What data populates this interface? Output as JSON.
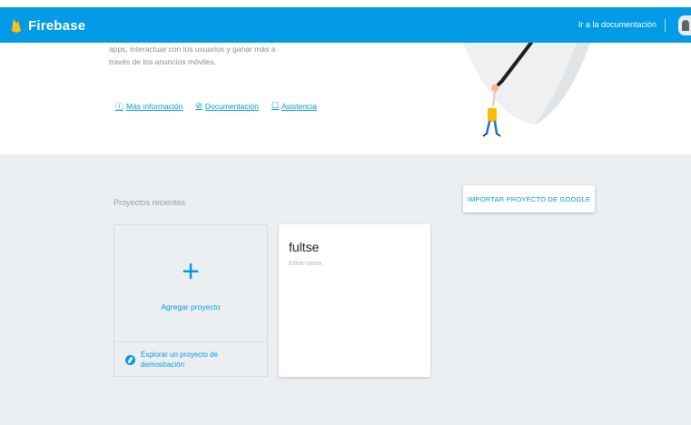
{
  "topbar": {
    "brand": "Firebase",
    "docs_link": "Ir a la documentación"
  },
  "hero": {
    "lines": [
      "apps, interactuar con los usuarios y ganar más a",
      "través de los anuncios móviles."
    ],
    "links": [
      {
        "icon": "info-icon",
        "label": "Más información"
      },
      {
        "icon": "doc-icon",
        "label": "Documentación"
      },
      {
        "icon": "support-icon",
        "label": "Asistencia"
      }
    ]
  },
  "projects": {
    "section_title": "Proyectos recientes",
    "import_button": "Importar proyecto de Google",
    "add_card": {
      "plus": "+",
      "label": "Agregar proyecto",
      "demo_label": "Explorar un proyecto de demostración"
    },
    "cards": [
      {
        "name": "fultse",
        "id": "fultse-xxxxx"
      }
    ]
  },
  "colors": {
    "topbar": "#039be5",
    "accent": "#039be5",
    "background": "#eceff1",
    "logo_flame": "#ffca28"
  }
}
